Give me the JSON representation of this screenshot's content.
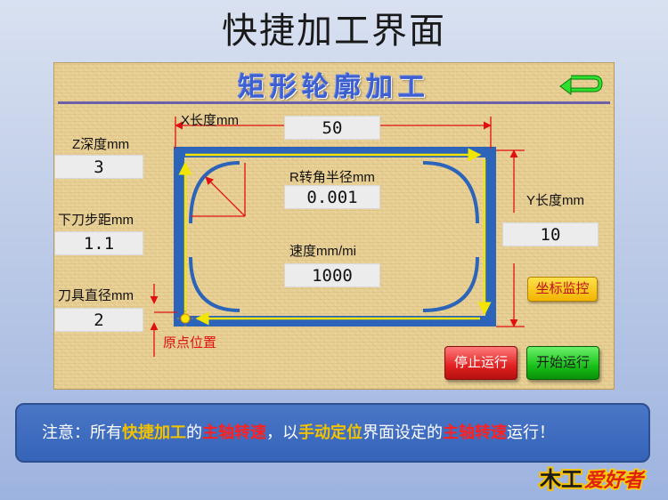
{
  "slide": {
    "title": "快捷加工界面"
  },
  "panel": {
    "title": "矩形轮廓加工",
    "back_icon": "return-arrow-icon",
    "fields": {
      "x_length": {
        "label": "X长度mm",
        "value": "50"
      },
      "y_length": {
        "label": "Y长度mm",
        "value": "10"
      },
      "z_depth": {
        "label": "Z深度mm",
        "value": "3"
      },
      "step_down": {
        "label": "下刀步距mm",
        "value": "1.1"
      },
      "tool_diameter": {
        "label": "刀具直径mm",
        "value": "2"
      },
      "corner_radius": {
        "label": "R转角半径mm",
        "value": "0.001"
      },
      "speed": {
        "label": "速度mm/mi",
        "value": "1000"
      }
    },
    "origin_label": "原点位置",
    "buttons": {
      "monitor": "坐标监控",
      "stop": "停止运行",
      "start": "开始运行"
    }
  },
  "notice": {
    "p1": "注意：所有",
    "p2": "快捷加工",
    "p3": "的",
    "p4": "主轴转速",
    "p5": "，以",
    "p6": "手动定位",
    "p7": "界面设定的",
    "p8": "主轴转速",
    "p9": "运行！"
  },
  "logo": {
    "text": "木工爱好者"
  },
  "colors": {
    "panel_bg": "#e8cf93",
    "title_blue": "#3d5fd0",
    "notice_bg": "#3a68ba",
    "highlight_yellow": "#f2c200",
    "highlight_red": "#ff2020",
    "frame_blue": "#2b64b8",
    "path_yellow": "#f2e600"
  }
}
